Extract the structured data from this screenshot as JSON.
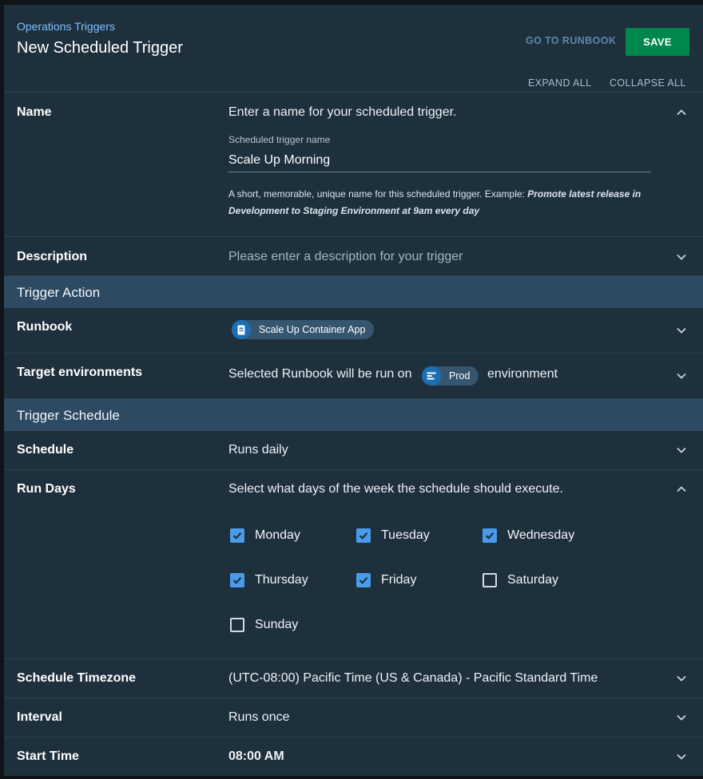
{
  "header": {
    "breadcrumb": "Operations Triggers",
    "title": "New Scheduled Trigger",
    "goto_runbook": "GO TO RUNBOOK",
    "save": "SAVE",
    "expand_all": "EXPAND ALL",
    "collapse_all": "COLLAPSE ALL"
  },
  "name": {
    "label": "Name",
    "summary": "Enter a name for your scheduled trigger.",
    "field_label": "Scheduled trigger name",
    "value": "Scale Up Morning",
    "hint": "A short, memorable, unique name for this scheduled trigger. Example: ",
    "hint_example": "Promote latest release in Development to Staging Environment at 9am every day"
  },
  "description": {
    "label": "Description",
    "placeholder": "Please enter a description for your trigger"
  },
  "trigger_action": {
    "heading": "Trigger Action",
    "runbook_label": "Runbook",
    "runbook_value": "Scale Up Container App",
    "target_label": "Target environments",
    "target_prefix": "Selected Runbook will be run on",
    "target_env": "Prod",
    "target_suffix": "environment"
  },
  "trigger_schedule": {
    "heading": "Trigger Schedule",
    "schedule_label": "Schedule",
    "schedule_value": "Runs daily",
    "run_days_label": "Run Days",
    "run_days_summary": "Select what days of the week the schedule should execute.",
    "days": [
      {
        "label": "Monday",
        "checked": true
      },
      {
        "label": "Tuesday",
        "checked": true
      },
      {
        "label": "Wednesday",
        "checked": true
      },
      {
        "label": "Thursday",
        "checked": true
      },
      {
        "label": "Friday",
        "checked": true
      },
      {
        "label": "Saturday",
        "checked": false
      },
      {
        "label": "Sunday",
        "checked": false
      }
    ],
    "timezone_label": "Schedule Timezone",
    "timezone_value": "(UTC-08:00) Pacific Time (US & Canada) - Pacific Standard Time",
    "interval_label": "Interval",
    "interval_value": "Runs once",
    "start_label": "Start Time",
    "start_value": "08:00 AM"
  },
  "colors": {
    "accent": "#00874d",
    "link": "#7fbfff",
    "checkbox": "#4a9bea",
    "section_bg": "#2e4a63",
    "panel_bg": "#1f303d"
  }
}
